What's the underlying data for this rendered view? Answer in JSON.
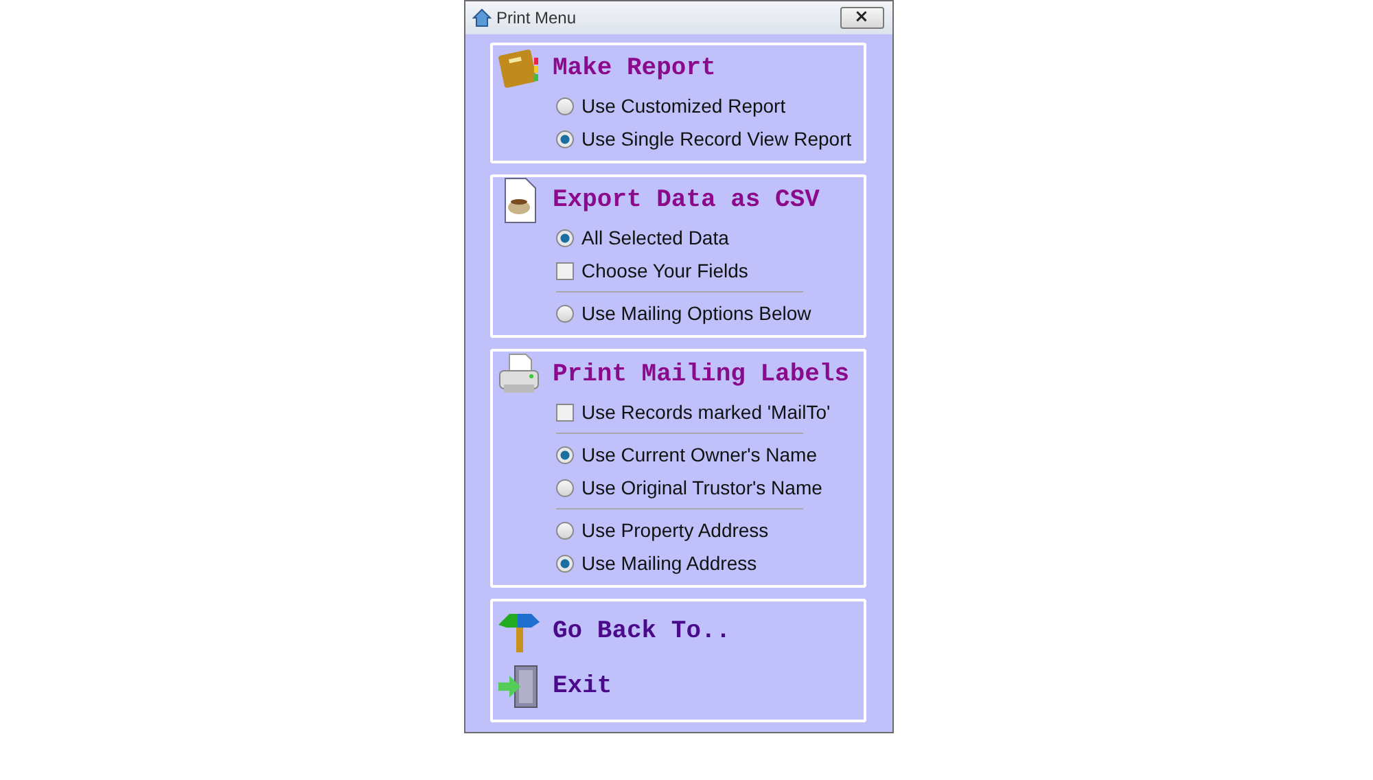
{
  "window": {
    "title": "Print Menu",
    "close": "×"
  },
  "panels": [
    {
      "kind": "options",
      "title": "Make Report",
      "options": [
        {
          "kind": "radio",
          "label": "Use Customized Report",
          "selected": false
        },
        {
          "kind": "radio",
          "label": "Use Single Record View Report",
          "selected": true
        }
      ]
    },
    {
      "kind": "options",
      "title": "Export Data as CSV",
      "options": [
        {
          "kind": "radio",
          "label": "All Selected Data",
          "selected": true
        },
        {
          "kind": "checkbox",
          "label": "Choose Your Fields",
          "checked": false
        },
        {
          "kind": "divider"
        },
        {
          "kind": "radio",
          "label": "Use Mailing Options Below",
          "selected": false
        }
      ]
    },
    {
      "kind": "options",
      "title": "Print Mailing Labels",
      "options": [
        {
          "kind": "checkbox",
          "label": "Use Records marked 'MailTo'",
          "checked": false
        },
        {
          "kind": "divider"
        },
        {
          "kind": "radio",
          "label": "Use Current Owner's Name",
          "selected": true
        },
        {
          "kind": "radio",
          "label": "Use Original Trustor's Name",
          "selected": false
        },
        {
          "kind": "divider"
        },
        {
          "kind": "radio",
          "label": "Use Property Address",
          "selected": false
        },
        {
          "kind": "radio",
          "label": "Use Mailing Address",
          "selected": true
        }
      ]
    },
    {
      "kind": "actions",
      "items": [
        {
          "label": "Go Back To.."
        },
        {
          "label": "Exit"
        }
      ]
    }
  ]
}
